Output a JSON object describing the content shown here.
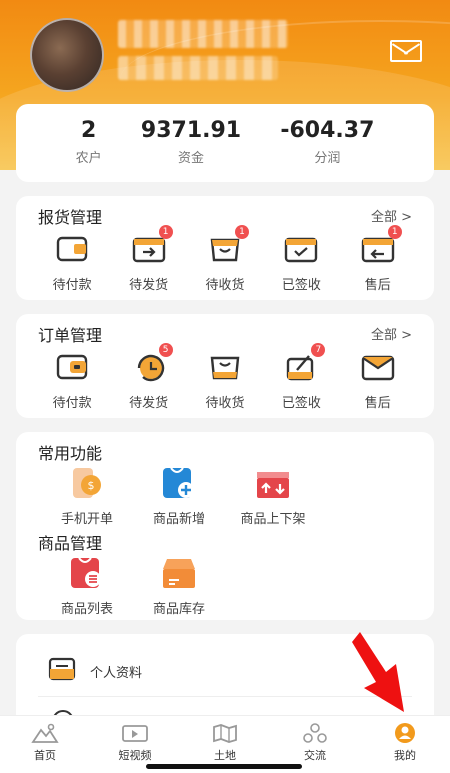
{
  "header": {
    "mail_icon": "mail-icon"
  },
  "stats": [
    {
      "value": "2",
      "label": "农户"
    },
    {
      "value": "9371.91",
      "label": "资金"
    },
    {
      "value": "-604.37",
      "label": "分润"
    }
  ],
  "report": {
    "title": "报货管理",
    "more": "全部 >",
    "items": [
      {
        "label": "待付款",
        "badge": ""
      },
      {
        "label": "待发货",
        "badge": "1"
      },
      {
        "label": "待收货",
        "badge": "1"
      },
      {
        "label": "已签收",
        "badge": ""
      },
      {
        "label": "售后",
        "badge": "1"
      }
    ]
  },
  "orders": {
    "title": "订单管理",
    "more": "全部 >",
    "items": [
      {
        "label": "待付款",
        "badge": ""
      },
      {
        "label": "待发货",
        "badge": "5"
      },
      {
        "label": "待收货",
        "badge": ""
      },
      {
        "label": "已签收",
        "badge": "7"
      },
      {
        "label": "售后",
        "badge": ""
      }
    ]
  },
  "functions": {
    "title": "常用功能",
    "items": [
      {
        "label": "手机开单",
        "icon": "phone-bill-icon"
      },
      {
        "label": "商品新增",
        "icon": "product-add-icon"
      },
      {
        "label": "商品上下架",
        "icon": "shelf-icon"
      }
    ]
  },
  "goods": {
    "title": "商品管理",
    "items": [
      {
        "label": "商品列表",
        "icon": "product-list-icon"
      },
      {
        "label": "商品库存",
        "icon": "stock-icon"
      }
    ]
  },
  "profile": {
    "label": "个人资料"
  },
  "nav": [
    {
      "label": "首页",
      "icon": "home-icon"
    },
    {
      "label": "短视频",
      "icon": "video-icon"
    },
    {
      "label": "土地",
      "icon": "land-map-icon"
    },
    {
      "label": "交流",
      "icon": "community-icon"
    },
    {
      "label": "我的",
      "icon": "profile-icon"
    }
  ],
  "colors": {
    "accent": "#f5a51f",
    "badge": "#f05050",
    "icon_orange": "#f3a536",
    "red": "#e4454a",
    "blue": "#2488d6"
  }
}
